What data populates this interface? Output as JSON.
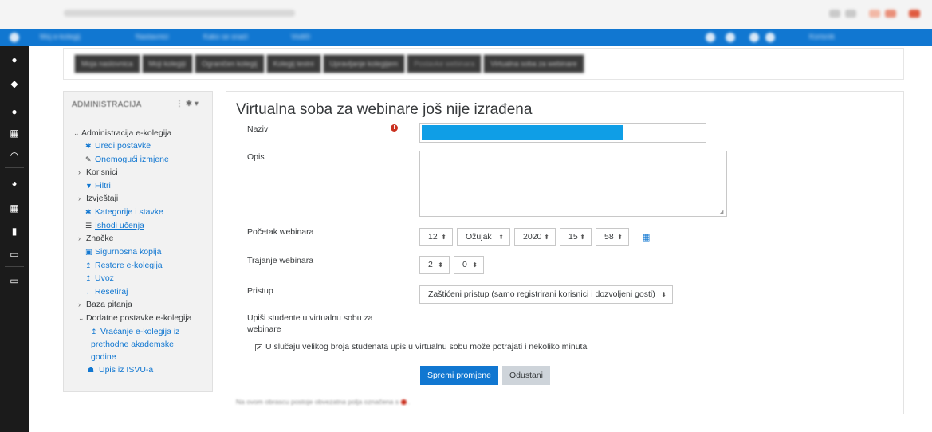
{
  "navbar": {
    "items": [
      "Moj e-kolegij",
      "Nastavnici",
      "Kako se snaći",
      "Vodiči"
    ],
    "user": "Korisnik"
  },
  "breadcrumb": [
    "Moja naslovnica",
    "Moji kolegiji",
    "Ograničen kolegij",
    "Kolegij testni",
    "Upravljanje kolegijem",
    "Postavke webinara",
    "Virtualna soba za webinare"
  ],
  "admin": {
    "title": "ADMINISTRACIJA",
    "ctrl": "⋮ ✱ ▾",
    "tree": [
      {
        "label": "Administracija e-kolegija",
        "level": 1,
        "arrow": "⌄",
        "icon": ""
      },
      {
        "label": "Uredi postavke",
        "level": 2,
        "arrow": "",
        "icon": "gear-icon"
      },
      {
        "label": "Onemogući izmjene",
        "level": 2,
        "arrow": "",
        "icon": "pencil-icon"
      },
      {
        "label": "Korisnici",
        "level": 1,
        "arrow": "›",
        "icon": ""
      },
      {
        "label": "Filtri",
        "level": 2,
        "arrow": "",
        "icon": "filter-icon"
      },
      {
        "label": "Izvještaji",
        "level": 1,
        "arrow": "›",
        "icon": ""
      },
      {
        "label": "Kategorije i stavke",
        "level": 2,
        "arrow": "",
        "icon": "gear-icon"
      },
      {
        "label": "Ishodi učenja",
        "level": 2,
        "arrow": "",
        "icon": "list-icon"
      },
      {
        "label": "Značke",
        "level": 1,
        "arrow": "›",
        "icon": ""
      },
      {
        "label": "Sigurnosna kopija",
        "level": 2,
        "arrow": "",
        "icon": "file-icon"
      },
      {
        "label": "Restore e-kolegija",
        "level": 2,
        "arrow": "",
        "icon": "upload-icon"
      },
      {
        "label": "Uvoz",
        "level": 2,
        "arrow": "",
        "icon": "upload-icon"
      },
      {
        "label": "Resetiraj",
        "level": 2,
        "arrow": "",
        "icon": "arrow-left-icon"
      },
      {
        "label": "Baza pitanja",
        "level": 1,
        "arrow": "›",
        "icon": ""
      },
      {
        "label": "Dodatne postavke e-kolegija",
        "level": 1,
        "arrow": "⌄",
        "icon": ""
      },
      {
        "label": "Vraćanje e-kolegija iz",
        "level": 2,
        "arrow": "",
        "icon": "upload-icon"
      },
      {
        "label": "prethodne akademske",
        "level": 2,
        "arrow": "",
        "icon": ""
      },
      {
        "label": "godine",
        "level": 2,
        "arrow": "",
        "icon": ""
      },
      {
        "label": "Upis iz ISVU-a",
        "level": 2,
        "arrow": "",
        "icon": "user-add-icon"
      }
    ]
  },
  "form": {
    "title": "Virtualna soba za webinare još nije izrađena",
    "name_label": "Naziv",
    "desc_label": "Opis",
    "start_label": "Početak webinara",
    "start": {
      "day": "12",
      "month": "Ožujak",
      "year": "2020",
      "hour": "15",
      "minute": "58"
    },
    "duration_label": "Trajanje webinara",
    "duration": {
      "hours": "2",
      "minutes": "0"
    },
    "access_label": "Pristup",
    "access_value": "Zaštićeni pristup (samo registrirani korisnici i dozvoljeni gosti)",
    "enrol_label_1": "Upiši studente u virtualnu sobu za",
    "enrol_label_2": "webinare",
    "enrol_checkbox": "U slučaju velikog broja studenata upis u virtualnu sobu može potrajati i nekoliko minuta",
    "save_button": "Spremi promjene",
    "cancel_button": "Odustani",
    "required_note": "Na ovom obrascu postoje obvezatna polja označena s"
  }
}
